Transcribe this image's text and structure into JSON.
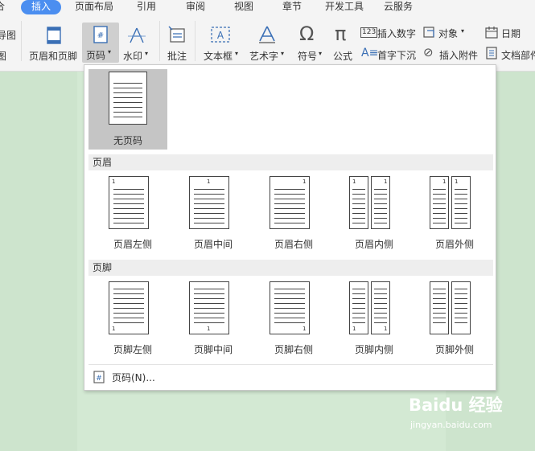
{
  "tabs": [
    {
      "label": "合",
      "active": false
    },
    {
      "label": "插入",
      "active": true
    },
    {
      "label": "页面布局",
      "active": false
    },
    {
      "label": "引用",
      "active": false
    },
    {
      "label": "审阅",
      "active": false
    },
    {
      "label": "视图",
      "active": false
    },
    {
      "label": "章节",
      "active": false
    },
    {
      "label": "开发工具",
      "active": false
    },
    {
      "label": "云服务",
      "active": false
    }
  ],
  "ribbon": {
    "left_cut_top": "导图",
    "left_cut_bottom": "图",
    "header_footer": "页眉和页脚",
    "page_number": "页码",
    "watermark": "水印",
    "comment": "批注",
    "textbox": "文本框",
    "wordart": "艺术字",
    "symbol": "符号",
    "formula": "公式",
    "insert_number": "插入数字",
    "drop_cap": "首字下沉",
    "object": "对象",
    "attachment": "插入附件",
    "date": "日期",
    "doc_parts": "文档部件"
  },
  "dropdown": {
    "none_label": "无页码",
    "header_section": "页眉",
    "footer_section": "页脚",
    "header_options": [
      "页眉左侧",
      "页眉中间",
      "页眉右侧",
      "页眉内侧",
      "页眉外侧"
    ],
    "footer_options": [
      "页脚左侧",
      "页脚中间",
      "页脚右侧",
      "页脚内侧",
      "页脚外侧"
    ],
    "page_number_menu": "页码(N)...",
    "thumb_number": "1"
  },
  "watermark": {
    "brand": "Baidu 经验",
    "url": "jingyan.baidu.com"
  },
  "colors": {
    "accent": "#4b8ef0",
    "doc_background": "#cde4cd",
    "selected_item": "#c5c5c5"
  }
}
